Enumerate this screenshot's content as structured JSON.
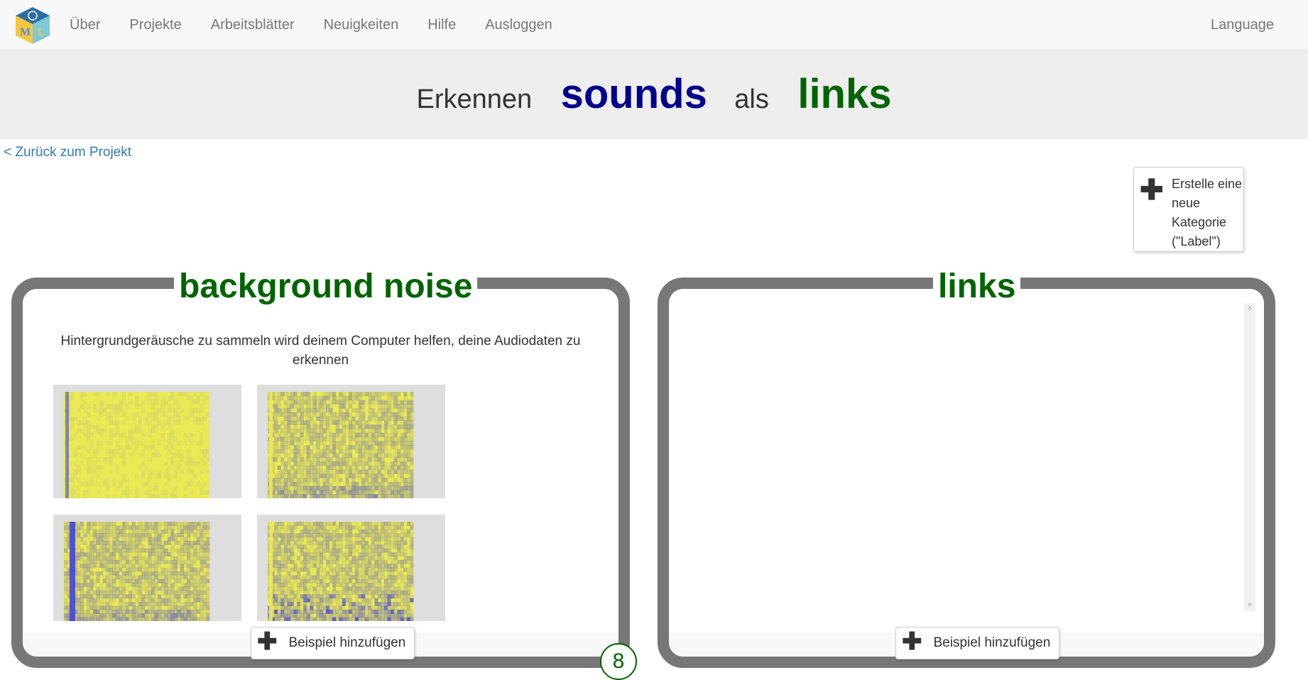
{
  "navbar": {
    "items": [
      "Über",
      "Projekte",
      "Arbeitsblätter",
      "Neuigkeiten",
      "Hilfe",
      "Ausloggen"
    ],
    "language": "Language",
    "logo_letters": {
      "m": "M",
      "l": "L"
    }
  },
  "title": {
    "recognise": "Erkennen",
    "data_type": "sounds",
    "as": "als",
    "label": "links"
  },
  "back_link": "< Zurück zum Projekt",
  "new_label_button": "Erstelle eine neue Kategorie (\"Label\")",
  "labels": [
    {
      "name": "background noise",
      "description": "Hintergrundgeräusche zu sammeln wird deinem Computer helfen, deine Audiodaten zu erkennen",
      "add_button": "Beispiel hinzufügen",
      "count": "8"
    },
    {
      "name": "links",
      "add_button": "Beispiel hinzufügen"
    }
  ],
  "colors": {
    "nav_bg": "#f8f8f8",
    "title_bg": "#eeeeee",
    "sounds_color": "#00008b",
    "label_color": "#006400",
    "box_border": "#777777",
    "link_color": "#337ab7",
    "spectrogram_yellow": "#eaea55",
    "spectrogram_blue": "#4444dd"
  }
}
